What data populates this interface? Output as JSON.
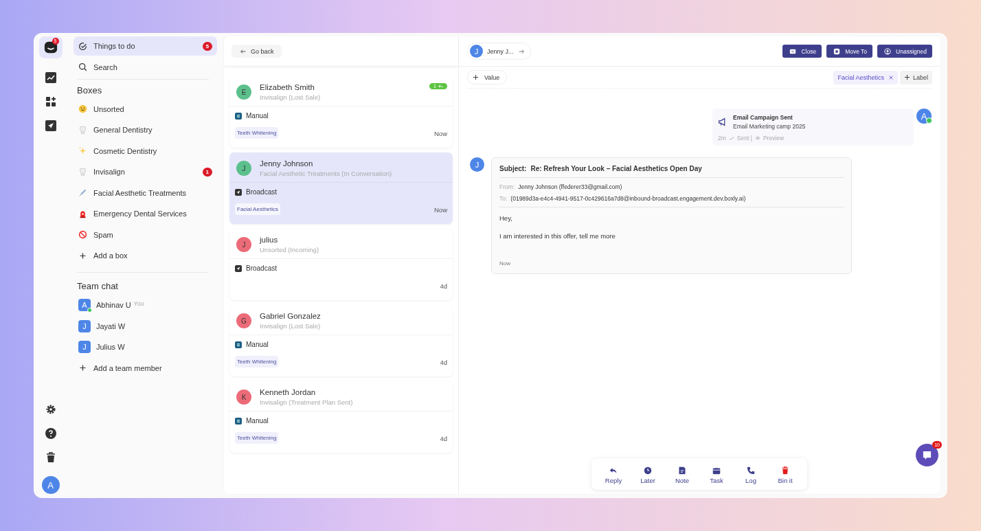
{
  "rail": {
    "app_badge": "5",
    "avatar": "A"
  },
  "sidebar": {
    "things_to_do": {
      "label": "Things to do",
      "count": "5",
      "selected": true
    },
    "search": "Search",
    "boxes_heading": "Boxes",
    "boxes": [
      {
        "label": "Unsorted",
        "kind": "smiley"
      },
      {
        "label": "General Dentistry",
        "kind": "tooth"
      },
      {
        "label": "Cosmetic Dentistry",
        "kind": "sparkles"
      },
      {
        "label": "Invisalign",
        "kind": "tooth",
        "count": "1"
      },
      {
        "label": "Facial Aesthetic Treatments",
        "kind": "syringe"
      },
      {
        "label": "Emergency Dental Services",
        "kind": "siren"
      },
      {
        "label": "Spam",
        "kind": "prohibited"
      }
    ],
    "add_box": "Add a box",
    "team_heading": "Team chat",
    "team": [
      {
        "initial": "A",
        "name": "Abhinav U",
        "note": "You",
        "online": true
      },
      {
        "initial": "J",
        "name": "Jayati W",
        "online": false
      },
      {
        "initial": "J",
        "name": "Julius W",
        "online": false
      }
    ],
    "add_member": "Add a team member"
  },
  "list": {
    "go_back": "Go back",
    "conversations": [
      {
        "initial": "E",
        "color": "#5cc08d",
        "name": "Elizabeth Smith",
        "sub": "Invisalign (Lost Sale)",
        "badge": "1",
        "kind": "manual",
        "channel": "Manual",
        "tag": "Teeth Whitening",
        "time": "Now",
        "selected": false
      },
      {
        "initial": "J",
        "color": "#5cc08d",
        "name": "Jenny Johnson",
        "sub": "Facial Aesthetic Treatments (In Conversation)",
        "kind": "broadcast",
        "channel": "Broadcast",
        "tag": "Facial Aesthetics",
        "time": "Now",
        "selected": true
      },
      {
        "initial": "J",
        "color": "#ec6b78",
        "name": "julius",
        "sub": "Unsorted (Incoming)",
        "kind": "broadcast",
        "channel": "Broadcast",
        "time": "4d",
        "selected": false
      },
      {
        "initial": "G",
        "color": "#ec6b78",
        "name": "Gabriel Gonzalez",
        "sub": "Invisalign (Lost Sale)",
        "kind": "manual",
        "channel": "Manual",
        "tag": "Teeth Whitening",
        "time": "4d",
        "selected": false
      },
      {
        "initial": "K",
        "color": "#ec6b78",
        "name": "Kenneth Jordan",
        "sub": "Invisalign (Treatment Plan Sent)",
        "kind": "manual",
        "channel": "Manual",
        "tag": "Teeth Whitening",
        "time": "4d",
        "selected": false
      }
    ]
  },
  "detail": {
    "contact": {
      "initial": "J",
      "name": "Jenny J..."
    },
    "actions": [
      {
        "kind": "close",
        "label": "Close"
      },
      {
        "kind": "move",
        "label": "Move To"
      },
      {
        "kind": "assign",
        "label": "Unassigned"
      }
    ],
    "value_button": "Value",
    "labels": [
      "Facial Aesthetics"
    ],
    "add_label": "Label",
    "campaign": {
      "title": "Email Campaign Sent",
      "subtitle": "Email Marketing camp 2025",
      "time": "2m",
      "status": "Sent |",
      "preview": "Preview",
      "avatar": "A"
    },
    "email": {
      "avatar": "J",
      "subject_label": "Subject:",
      "subject": "Re: Refresh Your Look – Facial Aesthetics Open Day",
      "from_label": "From:",
      "from": "Jenny Johnson (ffederer33@gmail.com)",
      "to_label": "To:",
      "to": "(01989d3a-e4c4-4941-9517-0c429616a7d8@inbound-broadcast.engagement.dev.boxly.ai)",
      "body": [
        "Hey,",
        "I am interested in this offer, tell me more"
      ],
      "time": "Now"
    },
    "toolbar": [
      {
        "kind": "reply",
        "label": "Reply"
      },
      {
        "kind": "later",
        "label": "Later"
      },
      {
        "kind": "note",
        "label": "Note"
      },
      {
        "kind": "task",
        "label": "Task"
      },
      {
        "kind": "log",
        "label": "Log"
      },
      {
        "kind": "bin",
        "label": "Bin it"
      }
    ],
    "chat_badge": "10"
  }
}
